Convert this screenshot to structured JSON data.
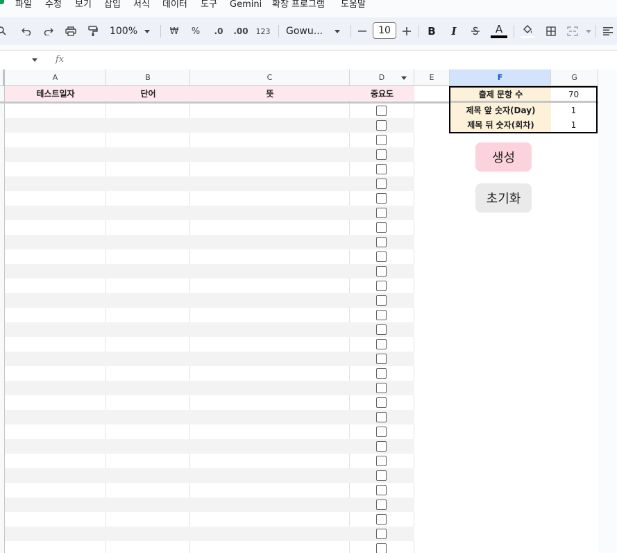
{
  "menu": [
    "파일",
    "수정",
    "보기",
    "삽입",
    "서식",
    "데이터",
    "도구",
    "Gemini",
    "확장 프로그램",
    "도움말"
  ],
  "toolbar": {
    "zoom": "100%",
    "currency": "₩",
    "percent": "%",
    "dec_decrease": ".0",
    "dec_increase": ".00",
    "number_format": "123",
    "font": "Gowu...",
    "font_size": "10",
    "bold": "B",
    "italic": "I",
    "text_color": "A"
  },
  "formula_bar": {
    "fx": "fx"
  },
  "columns": [
    "A",
    "B",
    "C",
    "D",
    "E",
    "F",
    "G"
  ],
  "header_row": {
    "a": "테스트일자",
    "b": "단어",
    "c": "뜻",
    "d": "중요도"
  },
  "settings": [
    {
      "label": "출제 문항 수",
      "value": "70"
    },
    {
      "label": "제목 앞 숫자(Day)",
      "value": "1"
    },
    {
      "label": "제목 뒤 숫자(회차)",
      "value": "1"
    }
  ],
  "buttons": {
    "generate": "생성",
    "reset": "초기화"
  },
  "data_rows": 31,
  "colors": {
    "header_pink": "#fde8ed",
    "settings_label": "#fdf1da",
    "generate_button": "#fcd3dd",
    "reset_button": "#eaeaea",
    "selected_column": "#d3e3fd"
  }
}
